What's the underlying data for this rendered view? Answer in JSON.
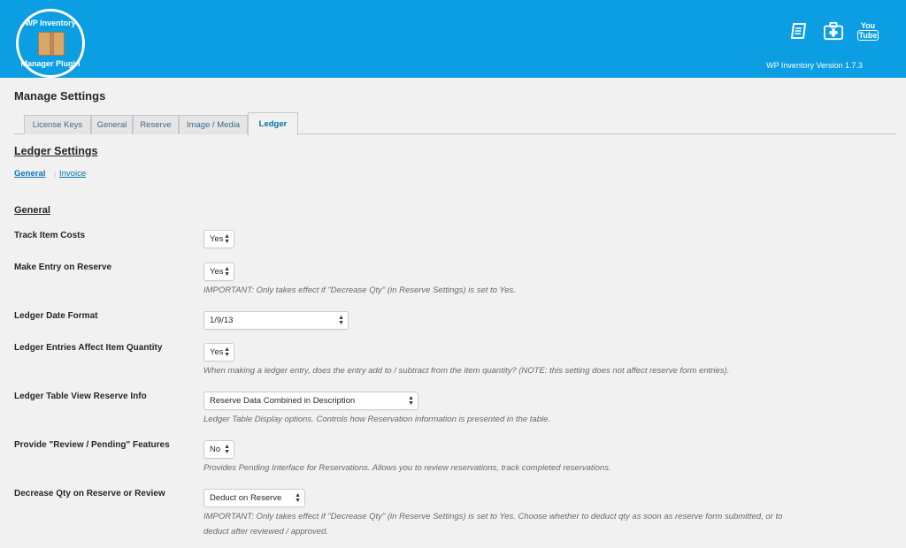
{
  "header": {
    "logo_line1": "WP Inventory",
    "logo_line2": "Manager Plugin",
    "icons": [
      "book-icon",
      "first-aid-kit-icon",
      "youtube-icon"
    ],
    "youtube_text_1": "You",
    "youtube_text_2": "Tube",
    "version": "WP Inventory Version 1.7.3",
    "brand_color": "#0b9ee3"
  },
  "page": {
    "title": "Manage Settings"
  },
  "tabs": [
    {
      "label": "License Keys"
    },
    {
      "label": "General"
    },
    {
      "label": "Reserve"
    },
    {
      "label": "Image / Media"
    },
    {
      "label": "Ledger",
      "active": true
    }
  ],
  "section": {
    "title": "Ledger Settings",
    "sublinks": [
      {
        "label": "General",
        "active": true
      },
      {
        "label": "Invoice"
      }
    ],
    "subhead": "General"
  },
  "settings": [
    {
      "label": "Track Item Costs",
      "value": "Yes",
      "description": ""
    },
    {
      "label": "Make Entry on Reserve",
      "value": "Yes",
      "description": "IMPORTANT: Only takes effect if \"Decrease Qty\" (in Reserve Settings) is set to Yes."
    },
    {
      "label": "Ledger Date Format",
      "value": "1/9/13",
      "description": ""
    },
    {
      "label": "Ledger Entries Affect Item Quantity",
      "value": "Yes",
      "description": "When making a ledger entry, does the entry add to / subtract from the item quantity? (NOTE: this setting does not affect reserve form entries)."
    },
    {
      "label": "Ledger Table View Reserve Info",
      "value": "Reserve Data Combined in Description",
      "description": "Ledger Table Display options. Controls how Reservation information is presented in the table."
    },
    {
      "label": "Provide \"Review / Pending\" Features",
      "value": "No",
      "description": "Provides Pending Interface for Reservations. Allows you to review reservations, track completed reservations."
    },
    {
      "label": "Decrease Qty on Reserve or Review",
      "value": "Deduct on Reserve",
      "description": "IMPORTANT: Only takes effect if \"Decrease Qty\" (in Reserve Settings) is set to Yes. Choose whether to deduct qty as soon as reserve form submitted, or to",
      "description_line2": "deduct after reviewed / approved."
    }
  ]
}
